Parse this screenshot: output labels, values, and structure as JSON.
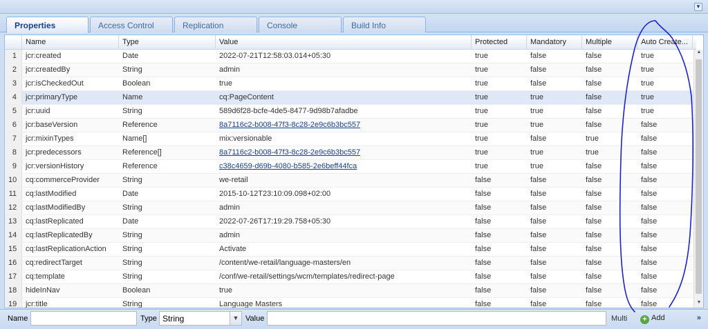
{
  "tabs": [
    {
      "label": "Properties",
      "active": true
    },
    {
      "label": "Access Control"
    },
    {
      "label": "Replication"
    },
    {
      "label": "Console"
    },
    {
      "label": "Build Info"
    }
  ],
  "columns": [
    "Name",
    "Type",
    "Value",
    "Protected",
    "Mandatory",
    "Multiple",
    "Auto Create..."
  ],
  "rows": [
    [
      "1",
      "jcr:created",
      "Date",
      "2022-07-21T12:58:03.014+05:30",
      "true",
      "false",
      "false",
      "true"
    ],
    [
      "2",
      "jcr:createdBy",
      "String",
      "admin",
      "true",
      "false",
      "false",
      "true"
    ],
    [
      "3",
      "jcr:isCheckedOut",
      "Boolean",
      "true",
      "true",
      "false",
      "false",
      "true"
    ],
    [
      "4",
      "jcr:primaryType",
      "Name",
      "cq:PageContent",
      "true",
      "true",
      "false",
      "true"
    ],
    [
      "5",
      "jcr:uuid",
      "String",
      "589d6f28-bcfe-4de5-8477-9d98b7afadbe",
      "true",
      "true",
      "false",
      "true"
    ],
    [
      "6",
      "jcr:baseVersion",
      "Reference",
      "8a7116c2-b008-47f3-8c28-2e9c6b3bc557",
      "true",
      "true",
      "false",
      "false"
    ],
    [
      "7",
      "jcr:mixinTypes",
      "Name[]",
      "mix:versionable",
      "true",
      "false",
      "true",
      "false"
    ],
    [
      "8",
      "jcr:predecessors",
      "Reference[]",
      "8a7116c2-b008-47f3-8c28-2e9c6b3bc557",
      "true",
      "true",
      "true",
      "false"
    ],
    [
      "9",
      "jcr:versionHistory",
      "Reference",
      "c38c4659-d69b-4080-b585-2e6beff44fca",
      "true",
      "true",
      "false",
      "false"
    ],
    [
      "10",
      "cq:commerceProvider",
      "String",
      "we-retail",
      "false",
      "false",
      "false",
      "false"
    ],
    [
      "11",
      "cq:lastModified",
      "Date",
      "2015-10-12T23:10:09.098+02:00",
      "false",
      "false",
      "false",
      "false"
    ],
    [
      "12",
      "cq:lastModifiedBy",
      "String",
      "admin",
      "false",
      "false",
      "false",
      "false"
    ],
    [
      "13",
      "cq:lastReplicated",
      "Date",
      "2022-07-26T17:19:29.758+05:30",
      "false",
      "false",
      "false",
      "false"
    ],
    [
      "14",
      "cq:lastReplicatedBy",
      "String",
      "admin",
      "false",
      "false",
      "false",
      "false"
    ],
    [
      "15",
      "cq:lastReplicationAction",
      "String",
      "Activate",
      "false",
      "false",
      "false",
      "false"
    ],
    [
      "16",
      "cq:redirectTarget",
      "String",
      "/content/we-retail/language-masters/en",
      "false",
      "false",
      "false",
      "false"
    ],
    [
      "17",
      "cq:template",
      "String",
      "/conf/we-retail/settings/wcm/templates/redirect-page",
      "false",
      "false",
      "false",
      "false"
    ],
    [
      "18",
      "hideInNav",
      "Boolean",
      "true",
      "false",
      "false",
      "false",
      "false"
    ],
    [
      "19",
      "jcr:title",
      "String",
      "Language Masters",
      "false",
      "false",
      "false",
      "false"
    ]
  ],
  "link_rows": [
    6,
    8,
    9
  ],
  "selected_row": 4,
  "toolbar": {
    "name_label": "Name",
    "name_value": "",
    "type_label": "Type",
    "type_value": "String",
    "value_label": "Value",
    "value_value": "",
    "multi_label": "Multi",
    "add_label": "Add",
    "more_label": "»"
  },
  "colors": {
    "annotation": "#1a22c8",
    "link": "#15428b",
    "selected_row": "#dfe8f6"
  },
  "icons": {
    "collapse": "double-chevron-down-icon",
    "add": "plus-circle-icon",
    "more": "double-chevron-right-icon"
  }
}
